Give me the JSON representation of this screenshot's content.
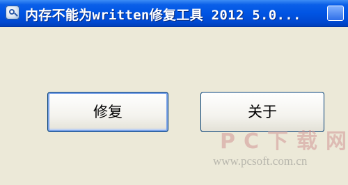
{
  "window": {
    "title": "内存不能为written修复工具 2012 5.0..."
  },
  "buttons": {
    "repair_label": "修复",
    "about_label": "关于"
  },
  "watermark": {
    "main": "PC下载网",
    "sub": "www.pcsoft.com.cn"
  },
  "colors": {
    "titlebar": "#0054e3",
    "window_bg": "#ece9d8",
    "button_border": "#003c74"
  }
}
